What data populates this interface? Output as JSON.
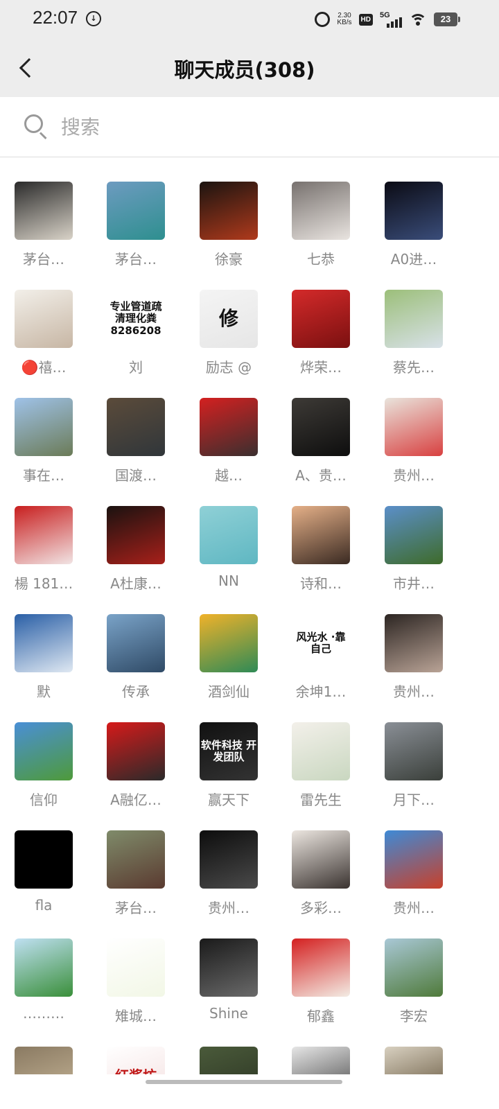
{
  "status_bar": {
    "time": "22:07",
    "left_icon_glyph": "↓",
    "net_speed_value": "2.30",
    "net_speed_unit": "KB/s",
    "hd_label": "HD",
    "network_label": "5G",
    "battery_level": "23"
  },
  "header": {
    "title": "聊天成员(308)",
    "back_icon": "chevron-left-icon"
  },
  "search": {
    "placeholder": "搜索",
    "icon": "search-icon"
  },
  "members": [
    {
      "name": "茅台…",
      "avatar_colors": [
        "#2a2a2a",
        "#d9d3c8"
      ],
      "avatar_text": ""
    },
    {
      "name": "茅台…",
      "avatar_colors": [
        "#6d9bc0",
        "#2e8f8f"
      ],
      "avatar_text": ""
    },
    {
      "name": "徐豪",
      "avatar_colors": [
        "#1b1410",
        "#b03a1c"
      ],
      "avatar_text": ""
    },
    {
      "name": "七恭",
      "avatar_colors": [
        "#77716e",
        "#e9e4e0"
      ],
      "avatar_text": ""
    },
    {
      "name": "A0进…",
      "avatar_colors": [
        "#0b0b14",
        "#3a4d7a"
      ],
      "avatar_text": ""
    },
    {
      "name": "🔴禧…",
      "avatar_colors": [
        "#f2efe9",
        "#c7b6a4"
      ],
      "avatar_text": ""
    },
    {
      "name": "刘",
      "avatar_colors": [
        "#ffffff",
        "#ffffff"
      ],
      "avatar_text": "专业管道疏 清理化粪 8286208"
    },
    {
      "name": "励志 @",
      "avatar_colors": [
        "#f4f4f4",
        "#e6e6e6"
      ],
      "avatar_text": "修"
    },
    {
      "name": "烨荣…",
      "avatar_colors": [
        "#d42a2a",
        "#7a1010"
      ],
      "avatar_text": ""
    },
    {
      "name": "蔡先…",
      "avatar_colors": [
        "#9cbf7a",
        "#d8e1e8"
      ],
      "avatar_text": ""
    },
    {
      "name": "事在…",
      "avatar_colors": [
        "#9fc2e8",
        "#6b7b57"
      ],
      "avatar_text": ""
    },
    {
      "name": "国渡…",
      "avatar_colors": [
        "#5b4b3a",
        "#30363a"
      ],
      "avatar_text": ""
    },
    {
      "name": "越…",
      "avatar_colors": [
        "#d42020",
        "#3a2f2f"
      ],
      "avatar_text": ""
    },
    {
      "name": "A、贵…",
      "avatar_colors": [
        "#3d3a36",
        "#0e0e0e"
      ],
      "avatar_text": ""
    },
    {
      "name": "贵州…",
      "avatar_colors": [
        "#e9e4dc",
        "#d84040"
      ],
      "avatar_text": ""
    },
    {
      "name": "楊 181…",
      "avatar_colors": [
        "#c81e1e",
        "#f1e4e4"
      ],
      "avatar_text": ""
    },
    {
      "name": "A杜康…",
      "avatar_colors": [
        "#1a1210",
        "#a8201a"
      ],
      "avatar_text": ""
    },
    {
      "name": "NN",
      "avatar_colors": [
        "#8fd0d6",
        "#5fb7c2"
      ],
      "avatar_text": ""
    },
    {
      "name": "诗和…",
      "avatar_colors": [
        "#e5b088",
        "#3a2a22"
      ],
      "avatar_text": ""
    },
    {
      "name": "市井…",
      "avatar_colors": [
        "#5b8fc9",
        "#3e6b2a"
      ],
      "avatar_text": ""
    },
    {
      "name": "默",
      "avatar_colors": [
        "#2a5fa6",
        "#dfe8f2"
      ],
      "avatar_text": ""
    },
    {
      "name": "传承",
      "avatar_colors": [
        "#7aa3c8",
        "#2f4a66"
      ],
      "avatar_text": ""
    },
    {
      "name": "酒剑仙",
      "avatar_colors": [
        "#f0b22a",
        "#2e8a56"
      ],
      "avatar_text": ""
    },
    {
      "name": "余坤1…",
      "avatar_colors": [
        "#ffffff",
        "#ffffff"
      ],
      "avatar_text": "风光水 ·靠自己"
    },
    {
      "name": "贵州…",
      "avatar_colors": [
        "#2c2522",
        "#b9a396"
      ],
      "avatar_text": ""
    },
    {
      "name": "信仰",
      "avatar_colors": [
        "#4a8fd6",
        "#4e9a3a"
      ],
      "avatar_text": ""
    },
    {
      "name": "A融亿…",
      "avatar_colors": [
        "#d61a1a",
        "#2a2a2a"
      ],
      "avatar_text": ""
    },
    {
      "name": "赢天下",
      "avatar_colors": [
        "#111111",
        "#333333"
      ],
      "avatar_text": "软件科技 开发团队"
    },
    {
      "name": "雷先生",
      "avatar_colors": [
        "#f3f0ea",
        "#c9d7c0"
      ],
      "avatar_text": ""
    },
    {
      "name": "月下…",
      "avatar_colors": [
        "#8a8f96",
        "#3a3f3a"
      ],
      "avatar_text": ""
    },
    {
      "name": "fla",
      "avatar_colors": [
        "#000000",
        "#000000"
      ],
      "avatar_text": ""
    },
    {
      "name": "茅台…",
      "avatar_colors": [
        "#7f8b6a",
        "#5a3a30"
      ],
      "avatar_text": ""
    },
    {
      "name": "贵州…",
      "avatar_colors": [
        "#0d0d0d",
        "#4a4a4a"
      ],
      "avatar_text": ""
    },
    {
      "name": "多彩…",
      "avatar_colors": [
        "#ece6e0",
        "#3a3330"
      ],
      "avatar_text": ""
    },
    {
      "name": "贵州…",
      "avatar_colors": [
        "#3e8ad6",
        "#c8402a"
      ],
      "avatar_text": ""
    },
    {
      "name": "………",
      "avatar_colors": [
        "#bfe0f2",
        "#3a8f3a"
      ],
      "avatar_text": ""
    },
    {
      "name": "雉城…",
      "avatar_colors": [
        "#ffffff",
        "#f2f7e6"
      ],
      "avatar_text": ""
    },
    {
      "name": "Shine",
      "avatar_colors": [
        "#1a1a1a",
        "#6a6a6a"
      ],
      "avatar_text": ""
    },
    {
      "name": "郁鑫",
      "avatar_colors": [
        "#d42020",
        "#f3ece4"
      ],
      "avatar_text": ""
    },
    {
      "name": "李宏",
      "avatar_colors": [
        "#a9c8d6",
        "#4f7a3a"
      ],
      "avatar_text": ""
    },
    {
      "name": "",
      "avatar_colors": [
        "#8a7a62",
        "#c9b89a"
      ],
      "avatar_text": ""
    },
    {
      "name": "",
      "avatar_colors": [
        "#ffffff",
        "#f3dede"
      ],
      "avatar_text": "红酱坊"
    },
    {
      "name": "",
      "avatar_colors": [
        "#4a5a3a",
        "#2a3322"
      ],
      "avatar_text": ""
    },
    {
      "name": "",
      "avatar_colors": [
        "#e6e6e6",
        "#3a3a3a"
      ],
      "avatar_text": ""
    },
    {
      "name": "",
      "avatar_colors": [
        "#d8d0c0",
        "#5a4a30"
      ],
      "avatar_text": ""
    }
  ]
}
